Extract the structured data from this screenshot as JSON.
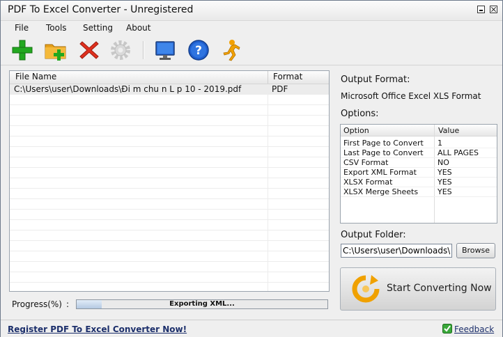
{
  "window": {
    "title": "PDF To Excel Converter - Unregistered"
  },
  "menu": [
    "File",
    "Tools",
    "Setting",
    "About"
  ],
  "toolbar": {
    "icons": [
      "add-file-icon",
      "add-folder-icon",
      "remove-icon",
      "settings-icon",
      "monitor-icon",
      "help-icon",
      "runner-icon"
    ],
    "colors": {
      "add": "#22a81f",
      "folder": "#e7a21b",
      "remove": "#e0301e",
      "help": "#1f5fcf",
      "runner": "#f2a100"
    }
  },
  "file_list": {
    "headers": {
      "name": "File Name",
      "format": "Format"
    },
    "rows": [
      {
        "name": "C:\\Users\\user\\Downloads\\Đi m chu n L p 10 - 2019.pdf",
        "format": "PDF"
      }
    ]
  },
  "output_format": {
    "label": "Output Format:",
    "value": "Microsoft Office Excel XLS Format"
  },
  "options": {
    "label": "Options:",
    "headers": {
      "option": "Option",
      "value": "Value"
    },
    "rows": [
      {
        "option": "First Page to Convert",
        "value": "1"
      },
      {
        "option": "Last Page to Convert",
        "value": "ALL PAGES"
      },
      {
        "option": "CSV Format",
        "value": "NO"
      },
      {
        "option": "Export XML Format",
        "value": "YES"
      },
      {
        "option": "XLSX Format",
        "value": "YES"
      },
      {
        "option": "XLSX Merge Sheets",
        "value": "YES"
      }
    ]
  },
  "output_folder": {
    "label": "Output Folder:",
    "value": "C:\\Users\\user\\Downloads\\",
    "browse_label": "Browse"
  },
  "convert": {
    "label": "Start Converting Now"
  },
  "progress": {
    "label": "Progress(%)",
    "colon": ":",
    "status": "Exporting XML...",
    "fraction": 0.1
  },
  "statusbar": {
    "register": "Register PDF To Excel Converter Now!",
    "feedback": "Feedback"
  }
}
